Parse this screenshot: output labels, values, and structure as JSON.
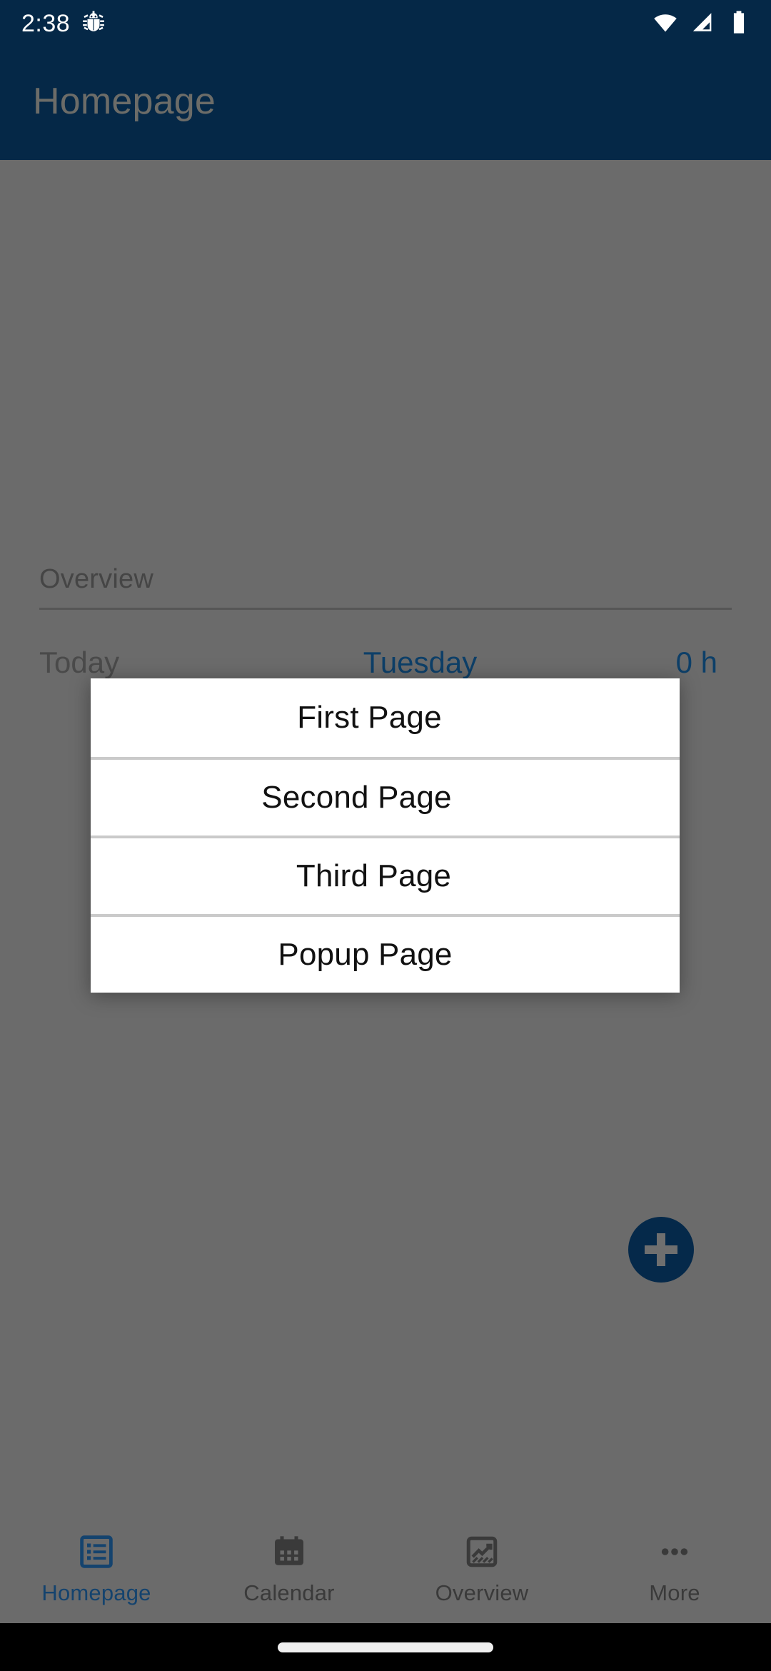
{
  "status_bar": {
    "time": "2:38",
    "icons": [
      "bug-icon",
      "wifi-icon",
      "cellular-signal-icon",
      "battery-icon"
    ]
  },
  "app_bar": {
    "title": "Homepage",
    "background_color": "#052847",
    "title_color_dimmed": "#6c6c68"
  },
  "background_page": {
    "section_title": "Overview",
    "row": {
      "today_label": "Today",
      "weekday": "Tuesday",
      "hours": "0 h"
    },
    "fab": {
      "icon": "plus-icon",
      "color": "#05294a"
    },
    "overlay_color": "#6b6b6b"
  },
  "dialog": {
    "items": [
      {
        "label": "First Page"
      },
      {
        "label": "Second Page"
      },
      {
        "label": "Third Page"
      },
      {
        "label": "Popup Page"
      }
    ],
    "background_color": "#ffffff",
    "divider_color": "#cacaca"
  },
  "bottom_nav": {
    "active_color": "#14436e",
    "idle_color": "#3a3a3a",
    "items": [
      {
        "label": "Homepage",
        "icon": "list-box-icon",
        "active": true
      },
      {
        "label": "Calendar",
        "icon": "calendar-icon",
        "active": false
      },
      {
        "label": "Overview",
        "icon": "chart-box-icon",
        "active": false
      },
      {
        "label": "More",
        "icon": "ellipsis-icon",
        "active": false
      }
    ]
  }
}
